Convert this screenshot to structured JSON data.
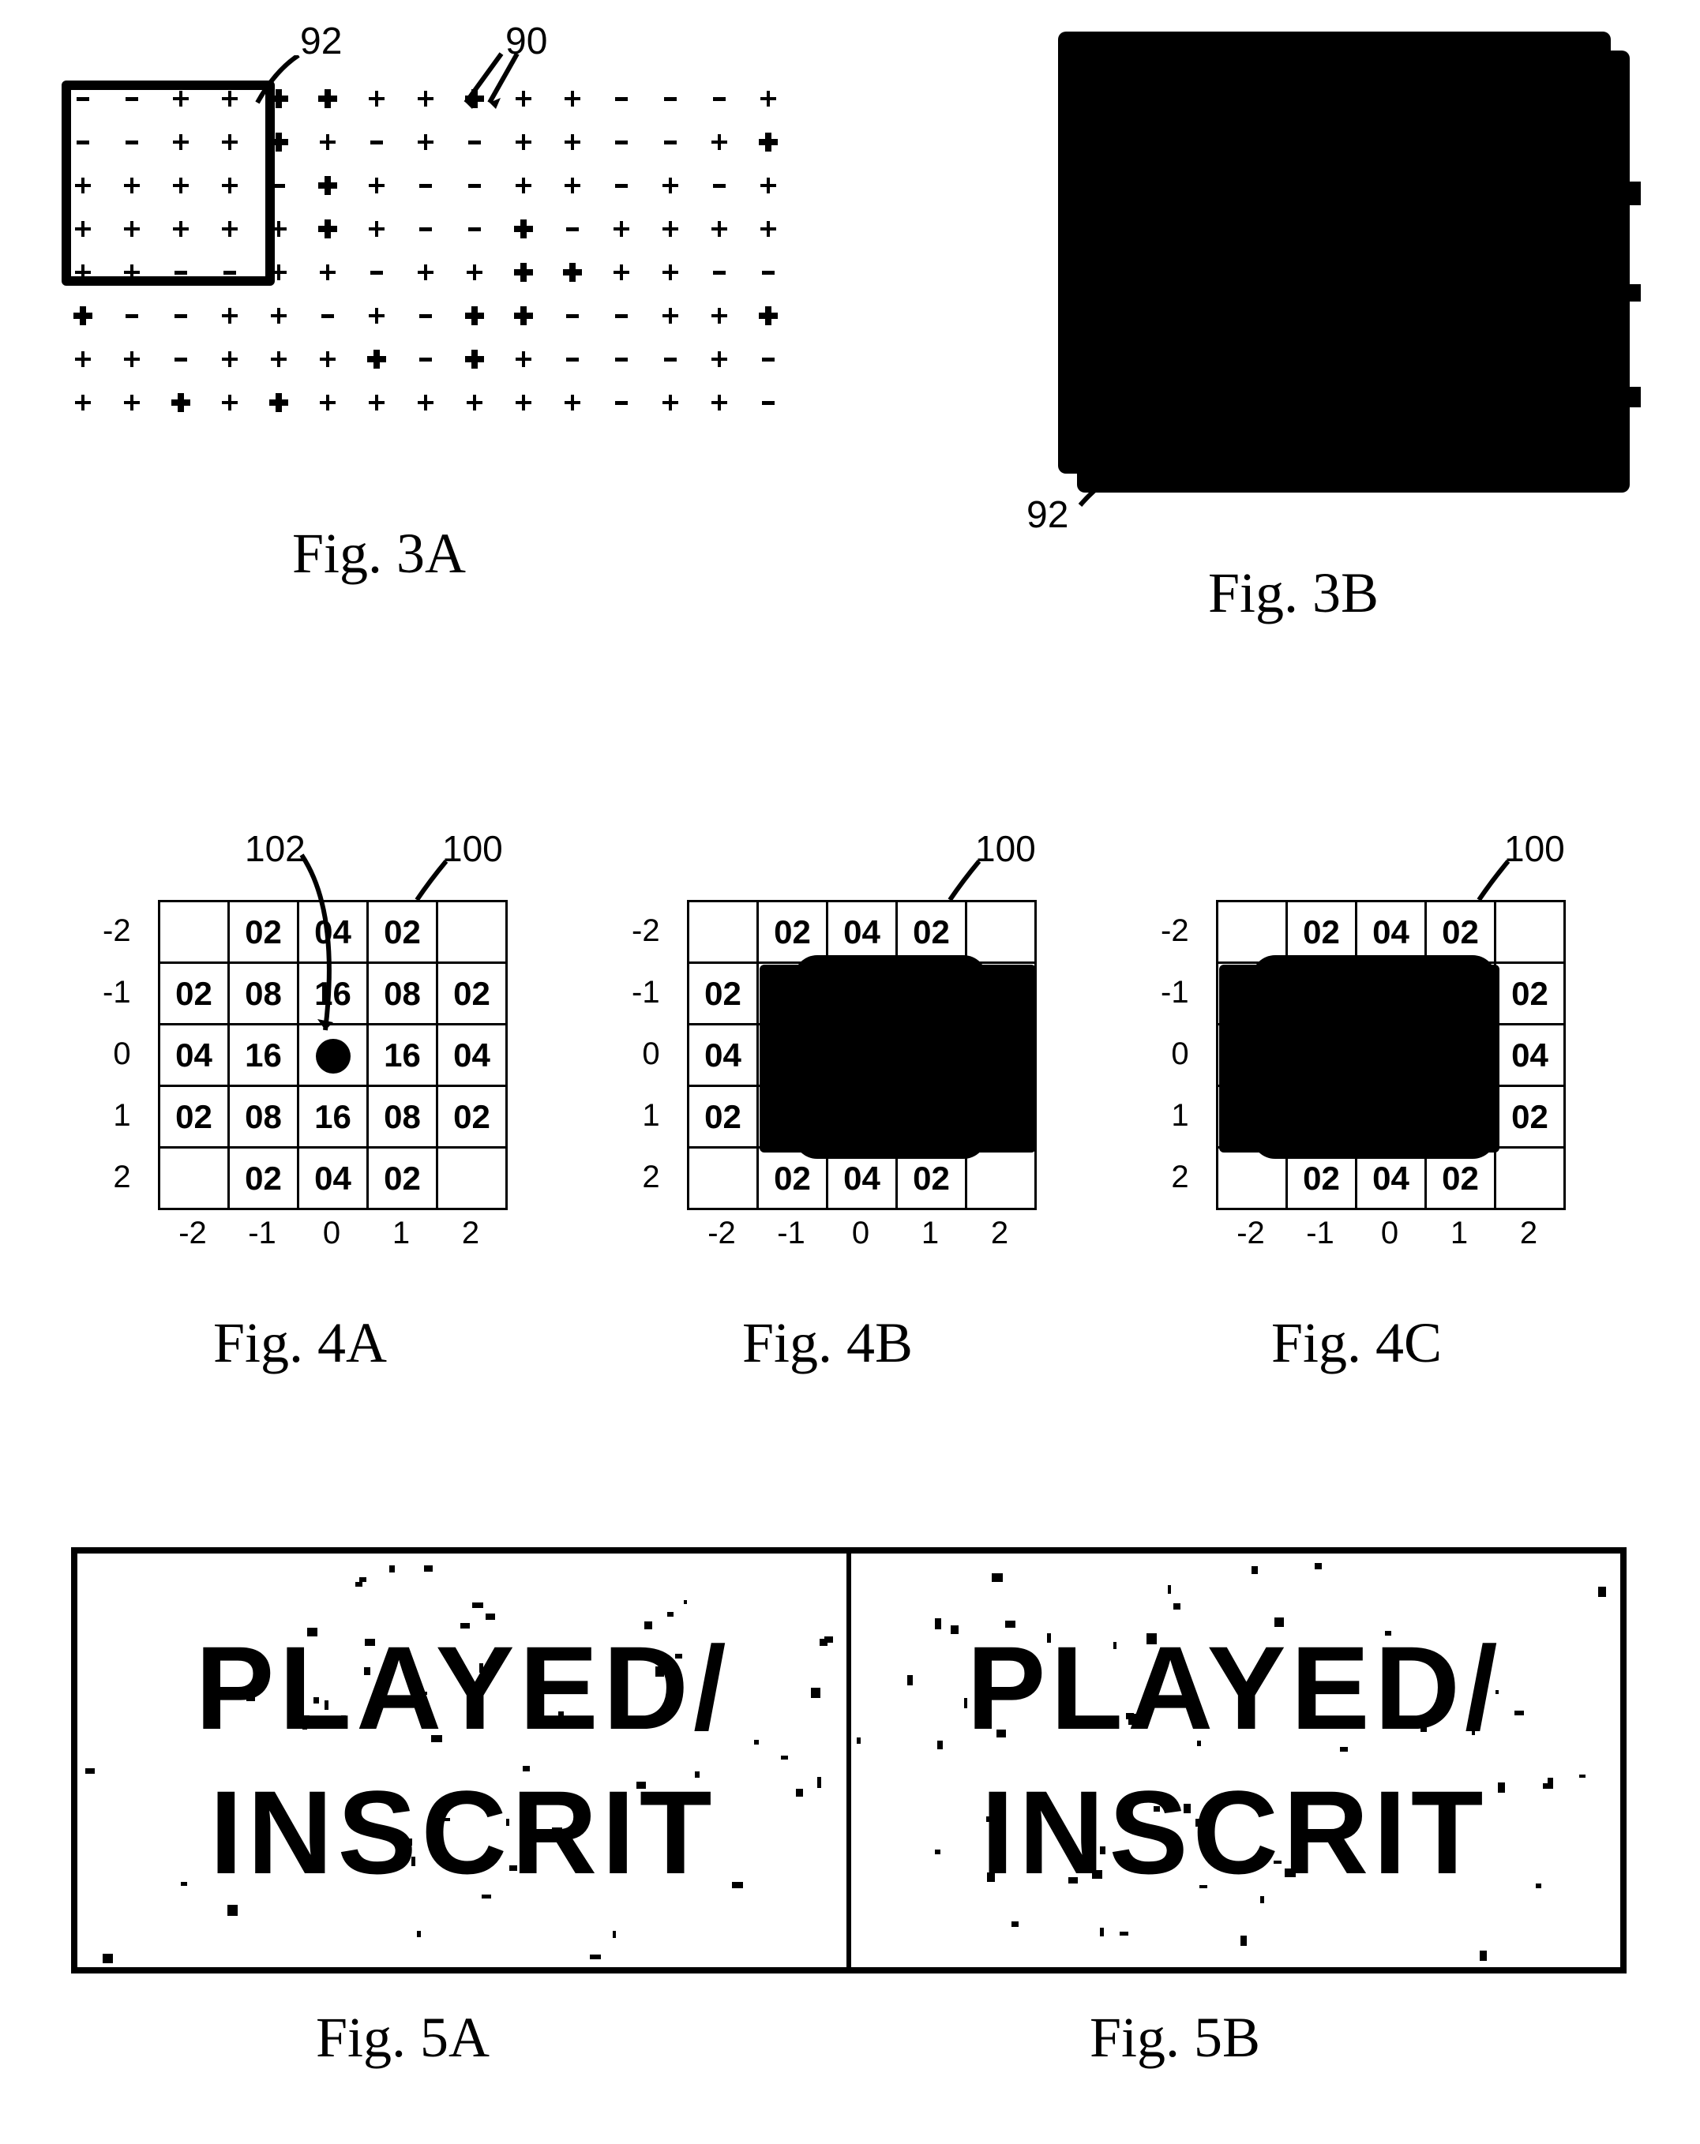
{
  "callouts": {
    "ref90": "90",
    "ref92_a": "92",
    "ref92_b": "92",
    "ref100_a": "100",
    "ref100_b": "100",
    "ref100_c": "100",
    "ref102": "102"
  },
  "captions": {
    "fig3a": "Fig. 3A",
    "fig3b": "Fig. 3B",
    "fig4a": "Fig. 4A",
    "fig4b": "Fig. 4B",
    "fig4c": "Fig. 4C",
    "fig5a": "Fig. 5A",
    "fig5b": "Fig. 5B"
  },
  "matrix": {
    "row_labels": [
      "-2",
      "-1",
      "0",
      "1",
      "2"
    ],
    "col_labels": [
      "-2",
      "-1",
      "0",
      "1",
      "2"
    ],
    "cells": [
      [
        "",
        "02",
        "04",
        "02",
        ""
      ],
      [
        "02",
        "08",
        "16",
        "08",
        "02"
      ],
      [
        "04",
        "16",
        "●",
        "16",
        "04"
      ],
      [
        "02",
        "08",
        "16",
        "08",
        "02"
      ],
      [
        "",
        "02",
        "04",
        "02",
        ""
      ]
    ],
    "cells_noncenter": [
      [
        "",
        "02",
        "04",
        "02",
        ""
      ],
      [
        "02",
        "08",
        "16",
        "08",
        "02"
      ],
      [
        "04",
        "16",
        "",
        "16",
        "04"
      ],
      [
        "02",
        "08",
        "16",
        "08",
        "02"
      ],
      [
        "",
        "02",
        "04",
        "02",
        ""
      ]
    ]
  },
  "fig5_text": {
    "line1": "PLAYED/",
    "line2": "INSCRIT"
  }
}
